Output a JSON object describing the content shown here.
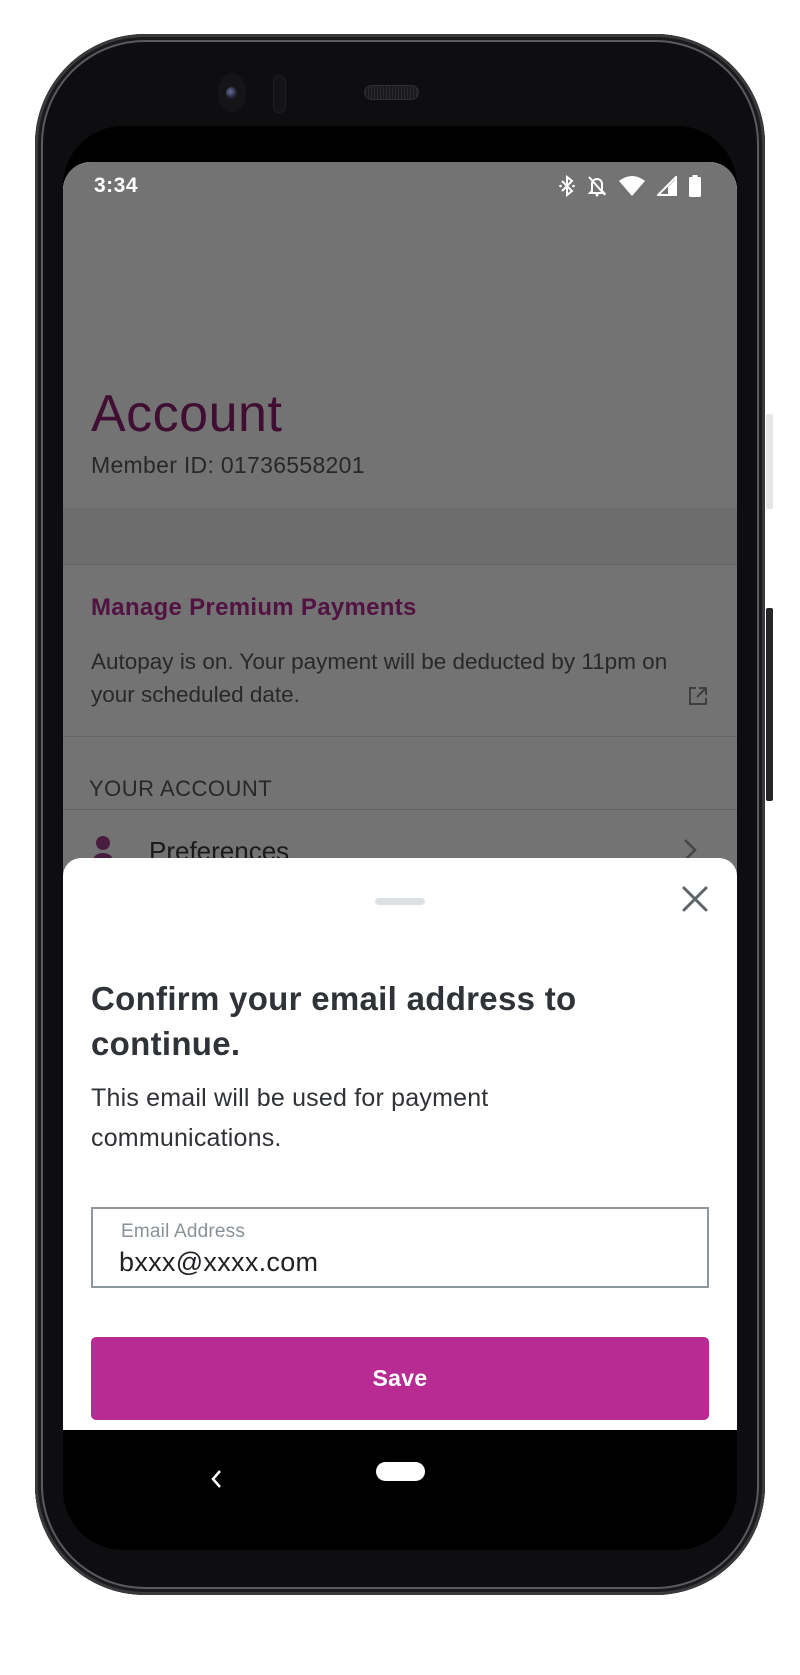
{
  "status_bar": {
    "time": "3:34",
    "icons": [
      "bluetooth-icon",
      "notifications-off-icon",
      "wifi-icon",
      "cell-signal-icon",
      "battery-icon"
    ]
  },
  "account_page": {
    "title": "Account",
    "member_id_label": "Member ID: 01736558201",
    "payments": {
      "link_label": "Manage Premium Payments",
      "description": "Autopay is on. Your payment will be deducted by 11pm on your scheduled date.",
      "icon": "external-link-icon"
    },
    "section_header": "YOUR ACCOUNT",
    "items": [
      {
        "label": "Preferences",
        "icon": "person-icon"
      }
    ]
  },
  "email_sheet": {
    "title": "Confirm your email address to continue.",
    "description": "This email will be used for payment communications.",
    "email_field": {
      "label": "Email Address",
      "value": "bxxx@xxxx.com"
    },
    "save_label": "Save",
    "close_icon": "close-icon"
  },
  "colors": {
    "brand": "#b72b93",
    "title_purple": "#8e1f6f",
    "text_dark": "#2f3236",
    "text_muted": "#58595b"
  },
  "nav_bar": {
    "buttons": [
      "back",
      "home"
    ]
  }
}
